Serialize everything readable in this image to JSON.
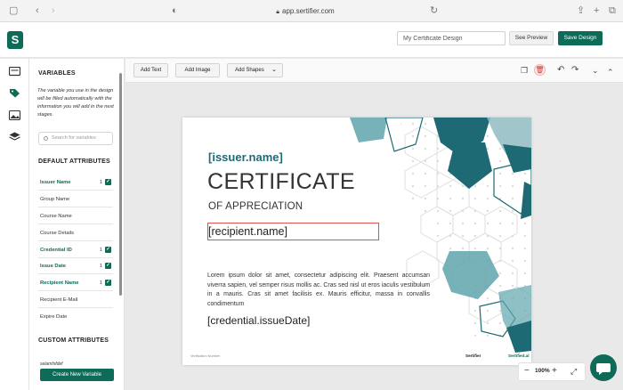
{
  "browser": {
    "url": "app.sertifier.com"
  },
  "header": {
    "logo_letter": "S",
    "design_name": "My Certificate Design",
    "preview_label": "See Preview",
    "save_label": "Save Design"
  },
  "panel": {
    "heading": "VARIABLES",
    "description": "The variable you use in the design will be filled automatically with the information you will add in the next stages.",
    "search_placeholder": "Search for variables",
    "default_heading": "DEFAULT ATTRIBUTES",
    "attributes": [
      {
        "label": "Issuer Name",
        "count": "1",
        "checked": true
      },
      {
        "label": "Group Name",
        "count": "",
        "checked": false
      },
      {
        "label": "Course Name",
        "count": "",
        "checked": false
      },
      {
        "label": "Course Details",
        "count": "",
        "checked": false
      },
      {
        "label": "Credential ID",
        "count": "1",
        "checked": true
      },
      {
        "label": "Issue Date",
        "count": "1",
        "checked": true
      },
      {
        "label": "Recipient Name",
        "count": "1",
        "checked": true
      },
      {
        "label": "Recipient E-Mail",
        "count": "",
        "checked": false
      },
      {
        "label": "Expire Date",
        "count": "",
        "checked": false
      }
    ],
    "custom_heading": "CUSTOM ATTRIBUTES",
    "custom_item": "selamfsfdef",
    "new_variable_label": "Create New Variable"
  },
  "toolbar": {
    "add_text": "Add Text",
    "add_image": "Add Image",
    "add_shapes": "Add Shapes"
  },
  "certificate": {
    "issuer": "[issuer.name]",
    "title": "CERTIFICATE",
    "subtitle": "OF APPRECIATION",
    "recipient": "[recipient.name]",
    "body": "Lorem ipsum dolor sit amet, consectetur adipiscing elit. Praesent accumsan viverra sapien, vel semper risus mollis ac. Cras sed nisl ut eros iaculis vestibulum in a mauris. Cras sit amet facilisis ex. Mauris efficitur, massa in convallis condimentum",
    "issue_date": "[credential.issueDate]",
    "verification": "Verification Number",
    "brand_left": "Sertifier",
    "brand_right": "Sertified.al"
  },
  "zoom": {
    "minus": "−",
    "value": "100%",
    "plus": "+"
  },
  "colors": {
    "brand": "#0d6b57",
    "accent_teal": "#1d6a74"
  }
}
